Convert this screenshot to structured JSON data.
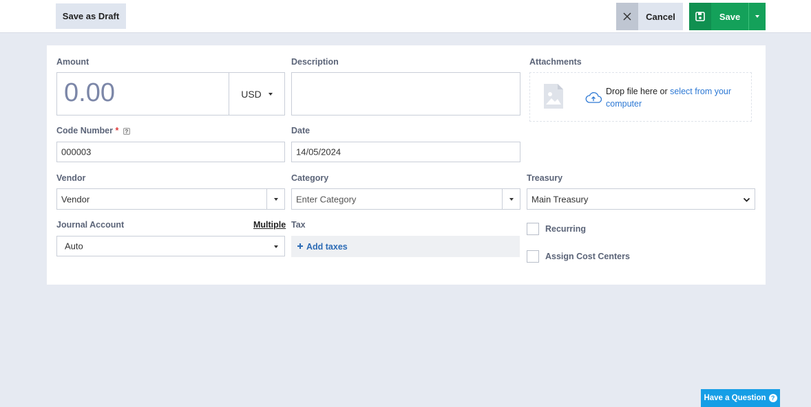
{
  "toolbar": {
    "save_draft_label": "Save as Draft",
    "cancel_label": "Cancel",
    "save_label": "Save"
  },
  "form": {
    "amount": {
      "label": "Amount",
      "value": "0.00",
      "currency": "USD"
    },
    "description": {
      "label": "Description",
      "value": ""
    },
    "attachments": {
      "label": "Attachments",
      "drop_text": "Drop file here or",
      "select_link": "select from your computer"
    },
    "code_number": {
      "label": "Code Number",
      "required_mark": "*",
      "help_icon": "?",
      "value": "000003"
    },
    "date": {
      "label": "Date",
      "value": "14/05/2024"
    },
    "vendor": {
      "label": "Vendor",
      "value": "Vendor"
    },
    "category": {
      "label": "Category",
      "placeholder": "Enter Category"
    },
    "treasury": {
      "label": "Treasury",
      "value": "Main Treasury",
      "options": [
        "Main Treasury"
      ]
    },
    "journal_account": {
      "label": "Journal Account",
      "multiple_link": "Multiple",
      "value": "Auto"
    },
    "tax": {
      "label": "Tax",
      "add_label": "Add taxes"
    },
    "recurring": {
      "label": "Recurring",
      "checked": false
    },
    "cost_centers": {
      "label": "Assign Cost Centers",
      "checked": false
    }
  },
  "help": {
    "label": "Have a Question",
    "icon": "?"
  },
  "colors": {
    "save_green": "#14a15a",
    "link_blue": "#2c78d4",
    "help_blue": "#169ee6",
    "page_bg": "#e6eaf2"
  }
}
